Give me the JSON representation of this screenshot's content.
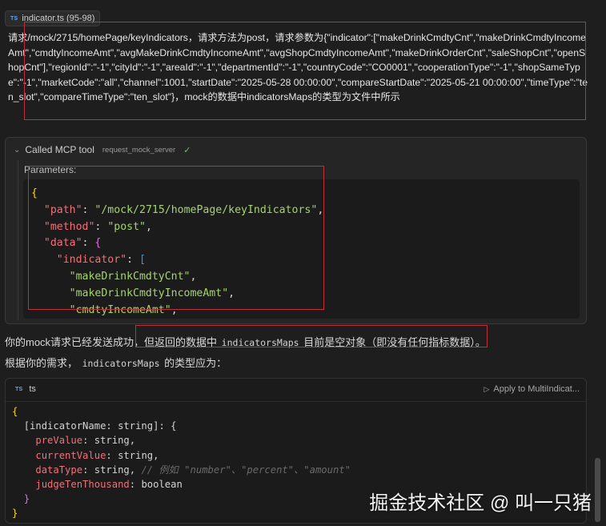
{
  "file_chip": {
    "badge": "TS",
    "label": "indicator.ts (95-98)"
  },
  "request": {
    "text": "请求/mock/2715/homePage/keyIndicators，请求方法为post，请求参数为{\"indicator\":[\"makeDrinkCmdtyCnt\",\"makeDrinkCmdtyIncomeAmt\",\"cmdtyIncomeAmt\",\"avgMakeDrinkCmdtyIncomeAmt\",\"avgShopCmdtyIncomeAmt\",\"makeDrinkOrderCnt\",\"saleShopCnt\",\"openShopCnt\"],\"regionId\":\"-1\",\"cityId\":\"-1\",\"areaId\":\"-1\",\"departmentId\":\"-1\",\"countryCode\":\"CO0001\",\"cooperationType\":\"-1\",\"shopSameType\":\"-1\",\"marketCode\":\"all\",\"channel\":1001,\"startDate\":\"2025-05-28 00:00:00\",\"compareStartDate\":\"2025-05-21 00:00:00\",\"timeType\":\"ten_slot\",\"compareTimeType\":\"ten_slot\"}，mock的数据中indicatorsMaps的类型为文件中所示"
  },
  "mcp": {
    "title": "Called MCP tool",
    "tool": "request_mock_server",
    "params_label": "Parameters:",
    "code": {
      "path_key": "\"path\"",
      "path_val": "\"/mock/2715/homePage/keyIndicators\"",
      "method_key": "\"method\"",
      "method_val": "\"post\"",
      "data_key": "\"data\"",
      "indicator_key": "\"indicator\"",
      "items": [
        "\"makeDrinkCmdtyCnt\"",
        "\"makeDrinkCmdtyIncomeAmt\"",
        "\"cmdtyIncomeAmt\""
      ]
    }
  },
  "response": {
    "line1_a": "你的mock请求已经发送成功，但返回的数据中 ",
    "line1_code": "indicatorsMaps",
    "line1_b": " 目前是空对象（即没有任何指标数据）。",
    "line2_a": "根据你的需求， ",
    "line2_code": "indicatorsMaps",
    "line2_b": " 的类型应为："
  },
  "ts_block": {
    "badge": "TS",
    "lang": "ts",
    "apply_label": "Apply to MultiIndicat...",
    "index_sig": "[indicatorName: string]: {",
    "fields": [
      {
        "name": "preValue",
        "type": ": string,"
      },
      {
        "name": "currentValue",
        "type": ": string,"
      },
      {
        "name": "dataType",
        "type": ": string,",
        "comment": "// 例如 \"number\"、\"percent\"、\"amount\""
      },
      {
        "name": "judgeTenThousand",
        "type": ": boolean"
      }
    ]
  },
  "watermark": "掘金技术社区 @ 叫一只猪",
  "colors": {
    "accent_red": "#c0303b",
    "bg": "#1e1e1f",
    "check_green": "#6fbf73"
  }
}
